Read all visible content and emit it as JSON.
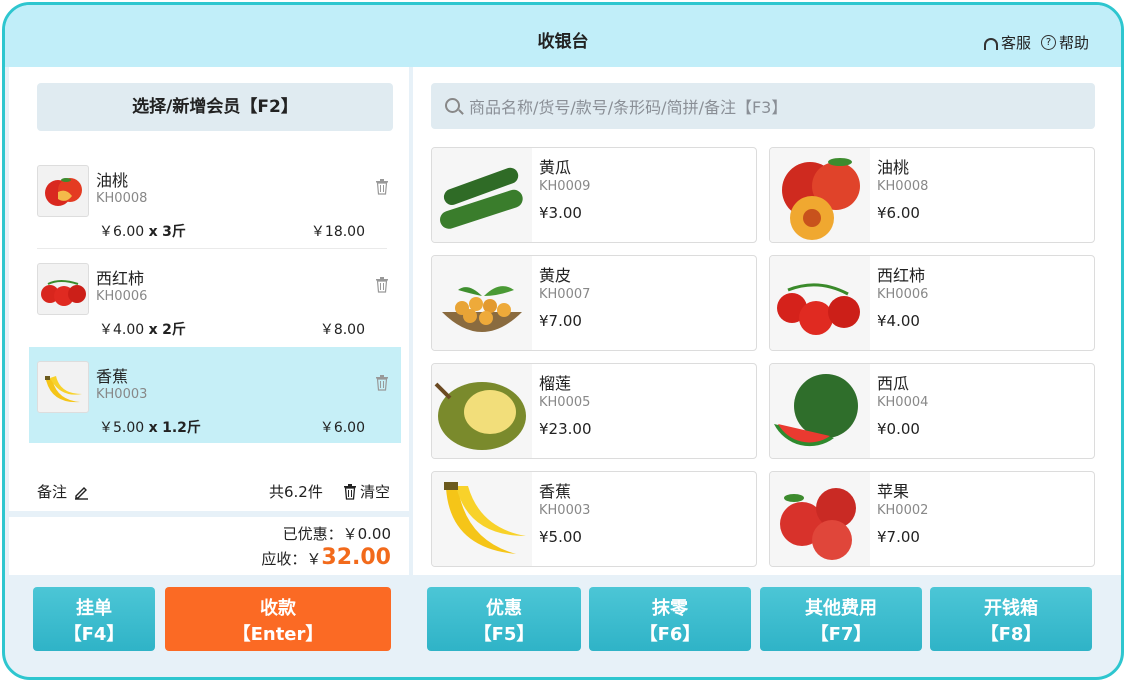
{
  "header": {
    "title": "收银台",
    "service_label": "客服",
    "help_label": "帮助"
  },
  "left": {
    "member_button": "选择/新增会员【F2】",
    "cart": [
      {
        "name": "油桃",
        "code": "KH0008",
        "unit_price": "￥6.00",
        "qty_prefix": "x",
        "qty": "3斤",
        "subtotal": "￥18.00",
        "fruit": "nectarine"
      },
      {
        "name": "西红柿",
        "code": "KH0006",
        "unit_price": "￥4.00",
        "qty_prefix": "x",
        "qty": "2斤",
        "subtotal": "￥8.00",
        "fruit": "tomato"
      },
      {
        "name": "香蕉",
        "code": "KH0003",
        "unit_price": "￥5.00",
        "qty_prefix": "x",
        "qty": "1.2斤",
        "subtotal": "￥6.00",
        "fruit": "banana",
        "selected": true
      }
    ],
    "remark_label": "备注",
    "count_text": "共6.2件",
    "clear_label": "清空",
    "discount_label": "已优惠：",
    "discount_value": "￥0.00",
    "due_label": "应收：",
    "due_currency": "￥",
    "due_value": "32.00"
  },
  "search": {
    "placeholder": "商品名称/货号/款号/条形码/简拼/备注【F3】"
  },
  "products": [
    {
      "name": "黄瓜",
      "code": "KH0009",
      "price": "¥3.00",
      "fruit": "cucumber"
    },
    {
      "name": "油桃",
      "code": "KH0008",
      "price": "¥6.00",
      "fruit": "nectarine"
    },
    {
      "name": "黄皮",
      "code": "KH0007",
      "price": "¥7.00",
      "fruit": "wampee"
    },
    {
      "name": "西红柿",
      "code": "KH0006",
      "price": "¥4.00",
      "fruit": "tomato"
    },
    {
      "name": "榴莲",
      "code": "KH0005",
      "price": "¥23.00",
      "fruit": "durian"
    },
    {
      "name": "西瓜",
      "code": "KH0004",
      "price": "¥0.00",
      "fruit": "watermelon"
    },
    {
      "name": "香蕉",
      "code": "KH0003",
      "price": "¥5.00",
      "fruit": "banana"
    },
    {
      "name": "苹果",
      "code": "KH0002",
      "price": "¥7.00",
      "fruit": "apple"
    }
  ],
  "footer_buttons": {
    "hang": {
      "label": "挂单",
      "key": "【F4】"
    },
    "pay": {
      "label": "收款",
      "key": "【Enter】"
    },
    "discount": {
      "label": "优惠",
      "key": "【F5】"
    },
    "round": {
      "label": "抹零",
      "key": "【F6】"
    },
    "other": {
      "label": "其他费用",
      "key": "【F7】"
    },
    "drawer": {
      "label": "开钱箱",
      "key": "【F8】"
    }
  },
  "colors": {
    "accent": "#2ec6cf",
    "header_bg": "#c1eef9",
    "pay_orange": "#fb6a24",
    "selected_row": "#c6eff7"
  }
}
